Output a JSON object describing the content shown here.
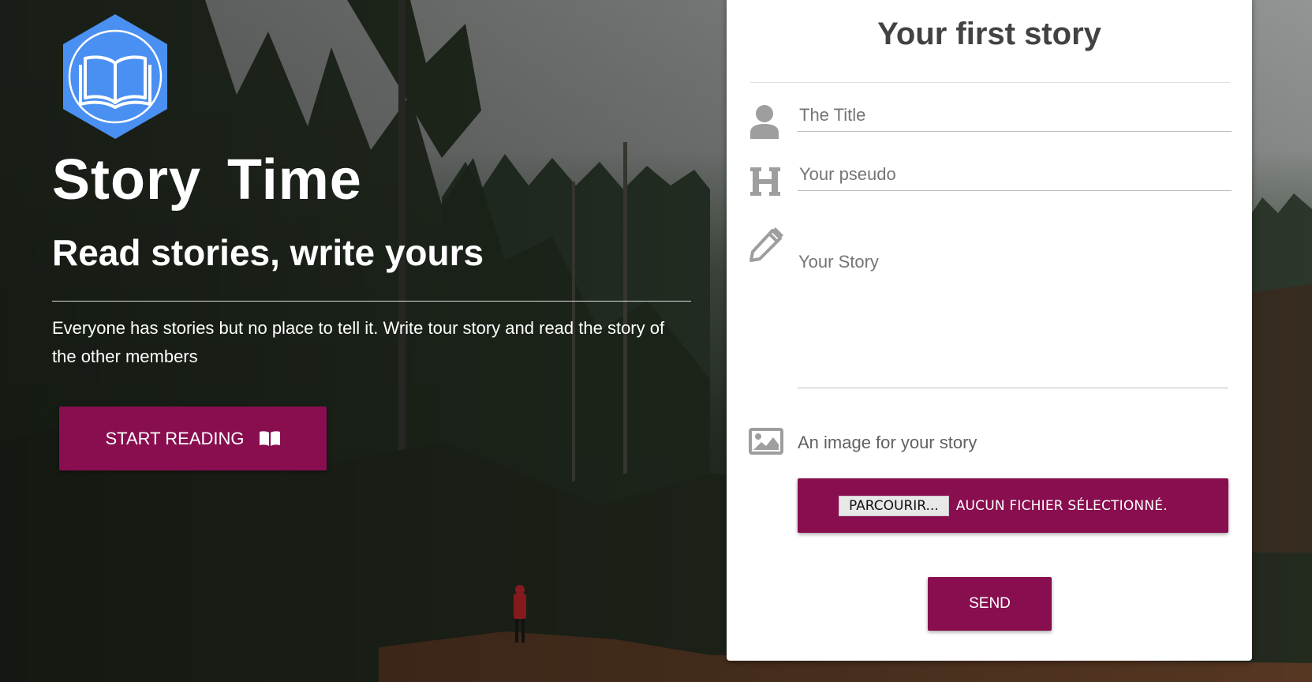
{
  "colors": {
    "accent": "#880e4f",
    "logo_blue": "#4a90f2",
    "card_bg": "#ffffff",
    "title_text": "#424242",
    "icon_gray": "#9e9e9e"
  },
  "hero": {
    "logo_icon": "open-book-icon",
    "title": "Story Time",
    "subtitle": "Read stories, write yours",
    "description": "Everyone has stories but no place to tell it. Write tour story and read the story of the other members",
    "start_button": {
      "label": "START READING",
      "icon": "open-book-icon"
    }
  },
  "form": {
    "title": "Your first story",
    "title_field": {
      "icon": "person-icon",
      "placeholder": "The Title",
      "value": ""
    },
    "pseudo_field": {
      "icon": "heading-h-icon",
      "placeholder": "Your pseudo",
      "value": ""
    },
    "story_field": {
      "icon": "pencil-icon",
      "placeholder": "Your Story",
      "value": ""
    },
    "image_field": {
      "icon": "image-icon",
      "label": "An image for your story",
      "browse_label": "PARCOURIR...",
      "status": "AUCUN FICHIER SÉLECTIONNÉ."
    },
    "send_label": "SEND"
  }
}
